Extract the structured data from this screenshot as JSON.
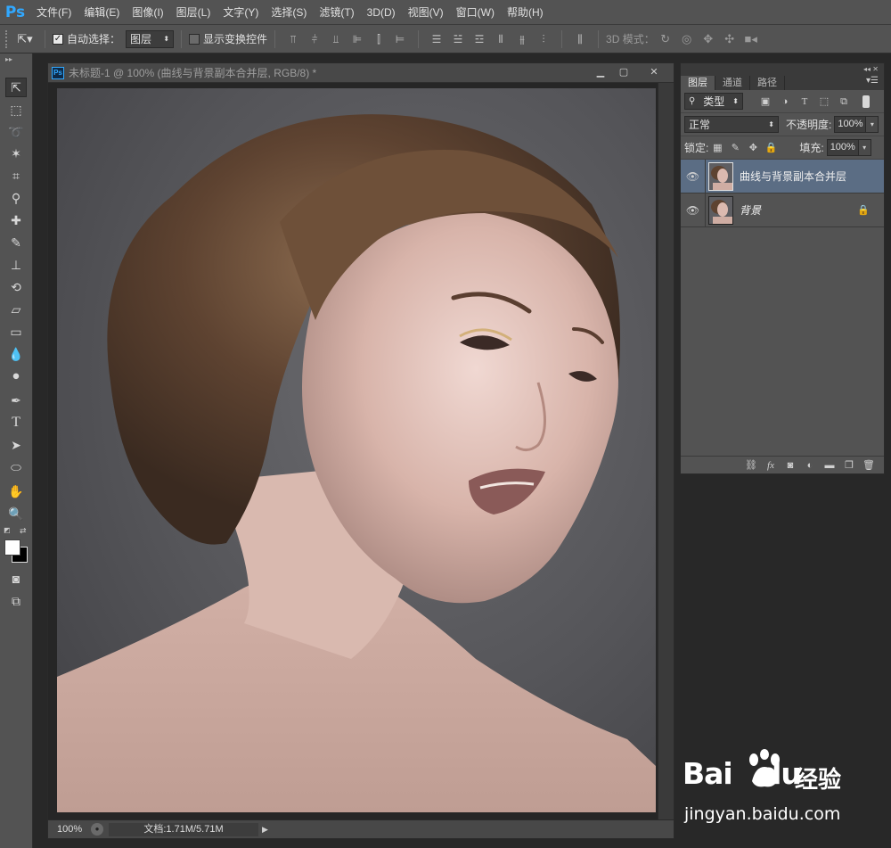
{
  "app": {
    "logo": "Ps"
  },
  "menu": [
    {
      "label": "文件(F)"
    },
    {
      "label": "编辑(E)"
    },
    {
      "label": "图像(I)"
    },
    {
      "label": "图层(L)"
    },
    {
      "label": "文字(Y)"
    },
    {
      "label": "选择(S)"
    },
    {
      "label": "滤镜(T)"
    },
    {
      "label": "3D(D)"
    },
    {
      "label": "视图(V)"
    },
    {
      "label": "窗口(W)"
    },
    {
      "label": "帮助(H)"
    }
  ],
  "options": {
    "auto_select_label": "自动选择：",
    "auto_select_checked": true,
    "auto_select_target": "图层",
    "show_transform_label": "显示变换控件",
    "show_transform_checked": false,
    "mode3d_label": "3D 模式："
  },
  "document": {
    "ps_icon": "Ps",
    "title": "未标题-1 @ 100% (曲线与背景副本合并层, RGB/8) *",
    "zoom": "100%",
    "doc_info": "文档:1.71M/5.71M"
  },
  "layers_panel": {
    "tabs": [
      {
        "label": "图层"
      },
      {
        "label": "通道"
      },
      {
        "label": "路径"
      }
    ],
    "filter_kind": "类型",
    "blend_mode": "正常",
    "opacity_label": "不透明度:",
    "opacity_value": "100%",
    "lock_label": "锁定:",
    "fill_label": "填充:",
    "fill_value": "100%",
    "layers": [
      {
        "name": "曲线与背景副本合并层",
        "selected": true,
        "locked": false
      },
      {
        "name": "背景",
        "selected": false,
        "locked": true
      }
    ]
  },
  "watermark": {
    "logo": "Bai",
    "logo_tail": "du",
    "cn": "经验",
    "url": "jingyan.baidu.com"
  },
  "colors": {
    "accent": "#31a8ff",
    "selected_layer": "#5b6d84",
    "panel_bg": "#535353"
  }
}
